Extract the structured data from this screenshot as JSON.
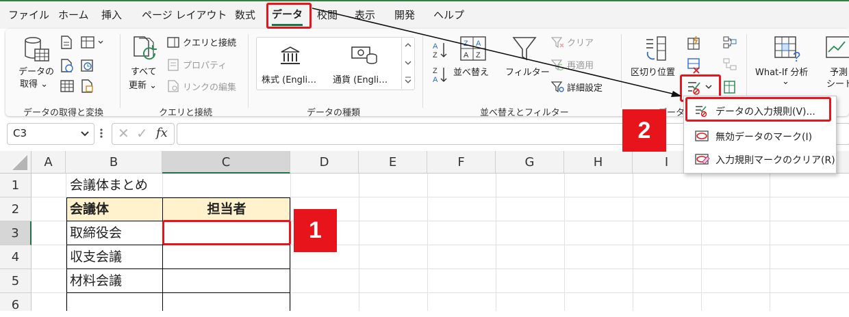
{
  "tabs": [
    "ファイル",
    "ホーム",
    "挿入",
    "ページ レイアウト",
    "数式",
    "データ",
    "校閲",
    "表示",
    "開発",
    "ヘルプ"
  ],
  "active_tab": "データ",
  "ribbon": {
    "get_data_l1": "データの",
    "get_data_l2": "取得 ⌄",
    "refresh_l1": "すべて",
    "refresh_l2": "更新 ⌄",
    "queries_connections": "クエリと接続",
    "properties": "プロパティ",
    "edit_links": "リンクの編集",
    "stocks": "株式 (Engli…",
    "currency": "通貨 (Engli…",
    "sort": "並べ替え",
    "filter": "フィルター",
    "clear": "クリア",
    "reapply": "再適用",
    "advanced": "詳細設定",
    "text_to_columns": "区切り位置",
    "whatif_l1": "What-If 分析",
    "whatif_l2": "⌄",
    "forecast_l1": "予測",
    "forecast_l2": "シート",
    "group_get_transform": "データの取得と変換",
    "group_queries": "クエリと接続",
    "group_data_types": "データの種類",
    "group_sort_filter": "並べ替えとフィルター",
    "group_data_tools": "データ"
  },
  "formula_bar": {
    "name_box": "C3",
    "fx": "fx",
    "cancel": "✕",
    "enter": "✓",
    "content": ""
  },
  "columns": [
    "A",
    "B",
    "C",
    "D",
    "E",
    "F",
    "G",
    "H",
    "I"
  ],
  "rows": [
    "1",
    "2",
    "3",
    "4",
    "5",
    "6"
  ],
  "cells": {
    "B1": "会議体まとめ",
    "B2": "会議体",
    "C2": "担当者",
    "B3": "取締役会",
    "B4": "収支会議",
    "B5": "材料会議"
  },
  "dropdown": {
    "items": [
      "データの入力規則(V)...",
      "無効データのマーク(I)",
      "入力規則マークのクリア(R)"
    ]
  },
  "badges": {
    "one": "1",
    "two": "2"
  },
  "colors": {
    "accent": "#1e7145",
    "highlight": "#e8141b",
    "header_fill": "#fff2cc"
  }
}
